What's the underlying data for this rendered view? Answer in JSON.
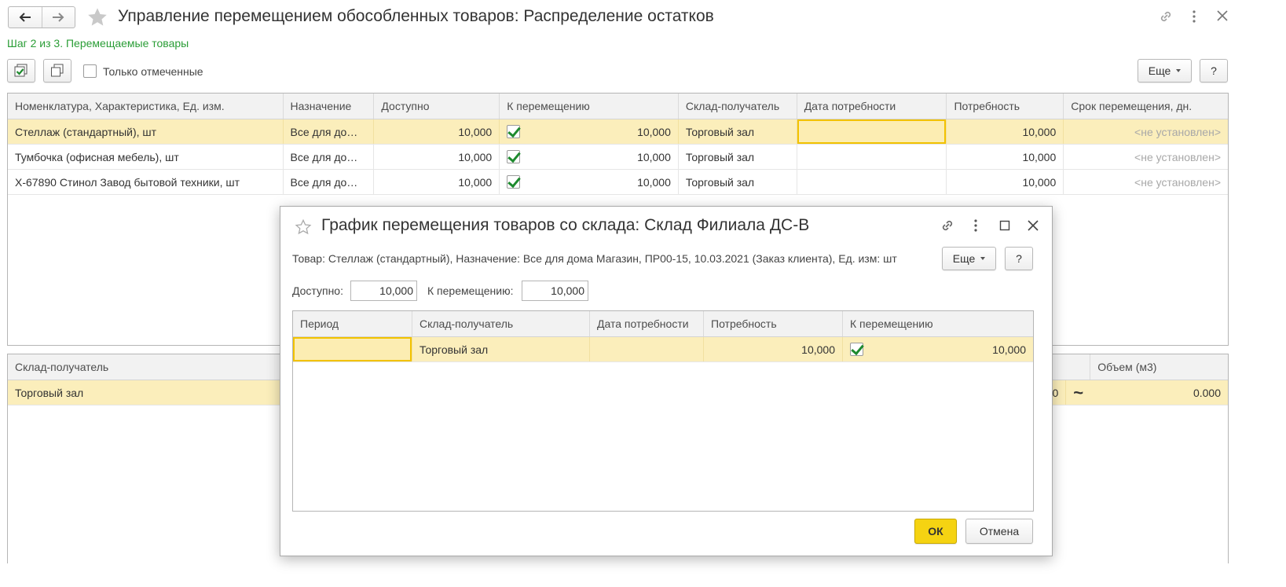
{
  "header": {
    "title": "Управление перемещением обособленных товаров: Распределение остатков",
    "step": "Шаг 2 из 3. Перемещаемые товары",
    "only_marked_label": "Только отмеченные",
    "more_label": "Еще",
    "help_label": "?"
  },
  "goods_table": {
    "columns": [
      "Номенклатура, Характеристика, Ед. изм.",
      "Назначение",
      "Доступно",
      "К перемещению",
      "Склад-получатель",
      "Дата потребности",
      "Потребность",
      "Срок перемещения, дн."
    ],
    "rows": [
      {
        "item": "Стеллаж (стандартный), шт",
        "purpose": "Все для до…",
        "available": "10,000",
        "checked": true,
        "to_move": "10,000",
        "warehouse": "Торговый зал",
        "date": "",
        "need": "10,000",
        "term": "<не установлен>"
      },
      {
        "item": "Тумбочка (офисная мебель), шт",
        "purpose": "Все для до…",
        "available": "10,000",
        "checked": true,
        "to_move": "10,000",
        "warehouse": "Торговый зал",
        "date": "",
        "need": "10,000",
        "term": "<не установлен>"
      },
      {
        "item": "Х-67890 Стинол Завод бытовой техники, шт",
        "purpose": "Все для до…",
        "available": "10,000",
        "checked": true,
        "to_move": "10,000",
        "warehouse": "Торговый зал",
        "date": "",
        "need": "10,000",
        "term": "<не установлен>"
      }
    ]
  },
  "bottom_table": {
    "col_warehouse": "Склад-получатель",
    "col_volume": "Объем (м3)",
    "row": {
      "warehouse": "Торговый зал",
      "partial_value": "0",
      "approx_sign": "~",
      "volume": "0.000"
    }
  },
  "dialog": {
    "title": "График перемещения товаров со склада: Склад Филиала ДС-В",
    "product_info": "Товар: Стеллаж (стандартный), Назначение: Все для дома Магазин, ПР00-15, 10.03.2021 (Заказ клиента), Ед. изм: шт",
    "more_label": "Еще",
    "help_label": "?",
    "available_label": "Доступно:",
    "available_value": "10,000",
    "to_move_label": "К перемещению:",
    "to_move_value": "10,000",
    "columns": [
      "Период",
      "Склад-получатель",
      "Дата потребности",
      "Потребность",
      "К перемещению"
    ],
    "rows": [
      {
        "period": "",
        "warehouse": "Торговый зал",
        "date": "",
        "need": "10,000",
        "checked": true,
        "to_move": "10,000"
      }
    ],
    "ok_label": "ОК",
    "cancel_label": "Отмена"
  },
  "colors": {
    "accent_yellow": "#f5d312",
    "selection": "#fbeebb",
    "step_green": "#2a9d36",
    "check_green": "#1e8a2e"
  }
}
